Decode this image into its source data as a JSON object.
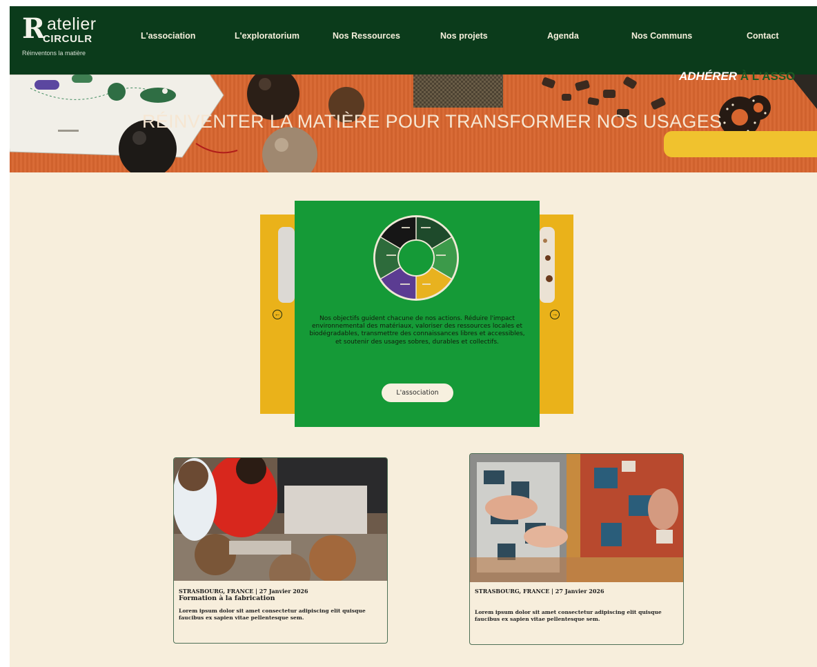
{
  "logo": {
    "mark": "R",
    "line1": "atelier",
    "line2": "CIRCULR",
    "tagline": "Réinventons la matière"
  },
  "nav": [
    {
      "label": "L'association"
    },
    {
      "label": "L'exploratorium"
    },
    {
      "label": "Nos Ressources"
    },
    {
      "label": "Nos projets"
    },
    {
      "label": "Agenda"
    },
    {
      "label": "Nos Communs"
    },
    {
      "label": "Contact"
    }
  ],
  "banner": {
    "title": "RÉINVENTER LA MATIÈRE POUR TRANSFORMER NOS USAGES",
    "cta_highlight": "ADHÉRER",
    "cta_rest": " À L'ASSO"
  },
  "carousel": {
    "mission_text": "Nos objectifs guident chacune de nos actions. Réduire l'impact environnemental des matériaux, valoriser des ressources locales et biodégradables, transmettre des connaissances libres et accessibles, et soutenir des usages sobres, durables et collectifs.",
    "button_label": "L'association",
    "prev_glyph": "←",
    "next_glyph": "→"
  },
  "events": [
    {
      "meta": "STRASBOURG, FRANCE | 27 Janvier 2026",
      "title": "Formation à la fabrication",
      "description": "Lorem ipsum dolor sit amet consectetur adipiscing elit quisque faucibus ex sapien vitae pellentesque sem."
    },
    {
      "meta": "STRASBOURG, FRANCE | 27 Janvier 2026",
      "title": "",
      "description": "Lorem ipsum dolor sit amet consectetur adipiscing elit quisque faucibus ex sapien vitae pellentesque sem."
    }
  ],
  "colors": {
    "header_bg": "#0b3b1b",
    "banner_orange": "#d8662f",
    "page_bg": "#f7eedc",
    "accent_green": "#159a37",
    "accent_yellow": "#eab21a"
  }
}
